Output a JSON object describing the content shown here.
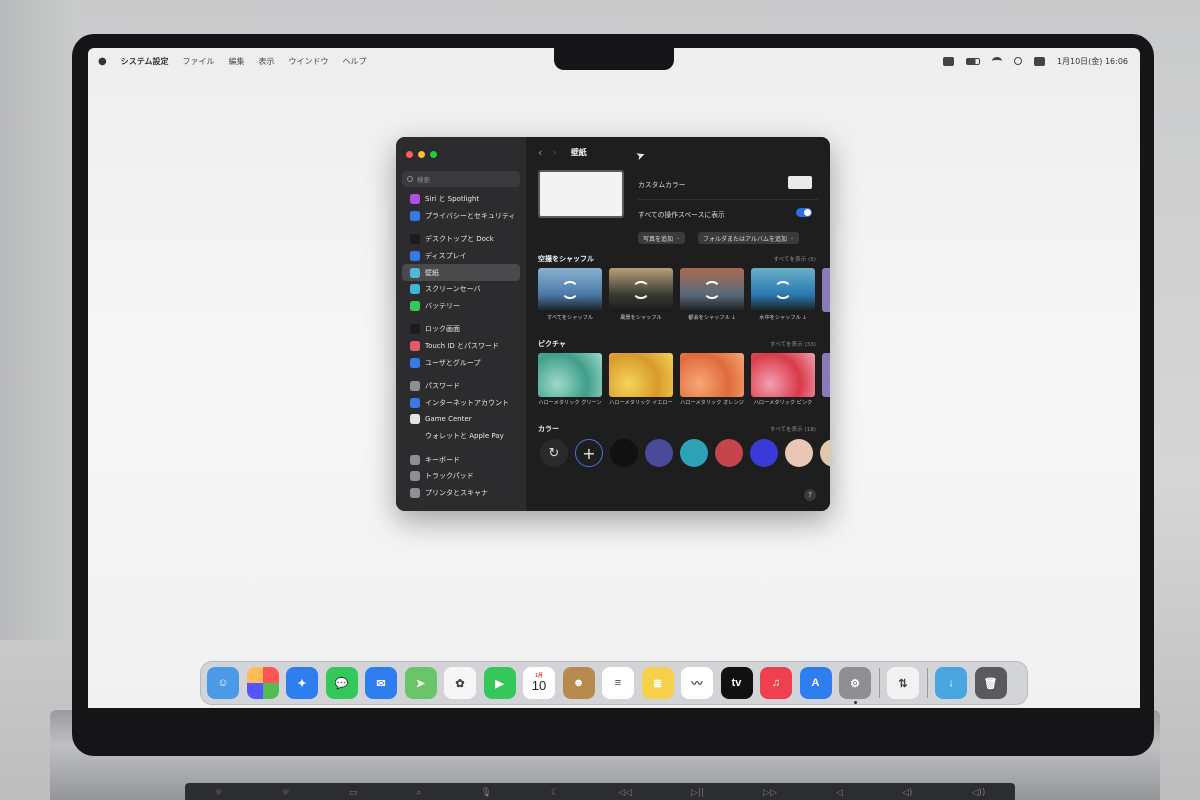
{
  "menubar": {
    "app_name": "システム設定",
    "menus": [
      "ファイル",
      "編集",
      "表示",
      "ウインドウ",
      "ヘルプ"
    ],
    "clock": "1月10日(金) 16:06"
  },
  "window": {
    "search_placeholder": "検索",
    "title": "壁紙",
    "sidebar_groups": [
      [
        {
          "label": "Siri と Spotlight",
          "icon": "siri-icon",
          "color": "#b04fe0"
        },
        {
          "label": "プライバシーとセキュリティ",
          "icon": "hand-icon",
          "color": "#3a7ae8"
        }
      ],
      [
        {
          "label": "デスクトップと Dock",
          "icon": "desktop-icon",
          "color": "#1c1c1e"
        },
        {
          "label": "ディスプレイ",
          "icon": "display-icon",
          "color": "#3a7ae8"
        },
        {
          "label": "壁紙",
          "icon": "wallpaper-icon",
          "color": "#4fb8d8",
          "active": true
        },
        {
          "label": "スクリーンセーバ",
          "icon": "screensaver-icon",
          "color": "#3fb6d6"
        },
        {
          "label": "バッテリー",
          "icon": "battery-icon",
          "color": "#34c759"
        }
      ],
      [
        {
          "label": "ロック画面",
          "icon": "lock-icon",
          "color": "#1c1c1e"
        },
        {
          "label": "Touch ID とパスワード",
          "icon": "fingerprint-icon",
          "color": "#e8566a"
        },
        {
          "label": "ユーザとグループ",
          "icon": "users-icon",
          "color": "#3a7ae8"
        }
      ],
      [
        {
          "label": "パスワード",
          "icon": "key-icon",
          "color": "#8e8e93"
        },
        {
          "label": "インターネットアカウント",
          "icon": "at-icon",
          "color": "#3a7ae8"
        },
        {
          "label": "Game Center",
          "icon": "gamecenter-icon",
          "color": "#e3e3e3"
        },
        {
          "label": "ウォレットと Apple Pay",
          "icon": "wallet-icon",
          "color": "#2b2b2b"
        }
      ],
      [
        {
          "label": "キーボード",
          "icon": "keyboard-icon",
          "color": "#8e8e93"
        },
        {
          "label": "トラックパッド",
          "icon": "trackpad-icon",
          "color": "#8e8e93"
        },
        {
          "label": "プリンタとスキャナ",
          "icon": "printer-icon",
          "color": "#8e8e93"
        }
      ]
    ],
    "custom_color_label": "カスタムカラー",
    "all_spaces_label": "すべての操作スペースに表示",
    "all_spaces_enabled": true,
    "add_photo_label": "写真を追加",
    "add_folder_label": "フォルダまたはアルバムを追加",
    "sections": {
      "shuffle": {
        "title": "空撮をシャッフル",
        "link": "すべてを表示 (5)",
        "items": [
          {
            "caption": "すべてをシャッフル",
            "colors": [
              "#4a7aa8",
              "#8ab0d0"
            ]
          },
          {
            "caption": "風景をシャッフル",
            "colors": [
              "#3a3a34",
              "#b8a078"
            ]
          },
          {
            "caption": "都会をシャッフル ↓",
            "colors": [
              "#5a6a7a",
              "#a86a50"
            ]
          },
          {
            "caption": "水中をシャッフル ↓",
            "colors": [
              "#2a7ab0",
              "#6ab0c8"
            ]
          }
        ]
      },
      "pictures": {
        "title": "ピクチャ",
        "link": "すべてを表示 (33)",
        "items": [
          {
            "caption": "ハローメタリック グリーン",
            "colors": [
              "#9fd8c8",
              "#3f9e8a"
            ]
          },
          {
            "caption": "ハローメタリック イエロー",
            "colors": [
              "#f4d45a",
              "#d89a2a"
            ]
          },
          {
            "caption": "ハローメタリック オレンジ",
            "colors": [
              "#f6a878",
              "#e06a3a"
            ]
          },
          {
            "caption": "ハローメタリック ピンク",
            "colors": [
              "#f2a0b0",
              "#d83a4a"
            ]
          }
        ]
      },
      "colors": {
        "title": "カラー",
        "link": "すべてを表示 (18)",
        "swatches": [
          "#111111",
          "#4a4a9a",
          "#2ea3b8",
          "#c8444c",
          "#3a3ad8",
          "#e8c8b4",
          "#e0c8a8"
        ]
      }
    }
  },
  "dock": {
    "apps": [
      {
        "name": "finder-app",
        "color": "#4a9ae8",
        "glyph": "☺"
      },
      {
        "name": "launchpad-app",
        "color": "#e8e8ea",
        "glyph": ""
      },
      {
        "name": "safari-app",
        "color": "#2f7ef0",
        "glyph": "✦"
      },
      {
        "name": "messages-app",
        "color": "#34c759",
        "glyph": "💬"
      },
      {
        "name": "mail-app",
        "color": "#2f7ef0",
        "glyph": "✉"
      },
      {
        "name": "maps-app",
        "color": "#6ac56a",
        "glyph": "➤"
      },
      {
        "name": "photos-app",
        "color": "#f6f6f6",
        "glyph": "✿"
      },
      {
        "name": "facetime-app",
        "color": "#34c759",
        "glyph": "▶"
      },
      {
        "name": "calendar-app",
        "color": "#ffffff",
        "glyph": ""
      },
      {
        "name": "contacts-app",
        "color": "#b98a4e",
        "glyph": "☻"
      },
      {
        "name": "reminders-app",
        "color": "#ffffff",
        "glyph": "≡"
      },
      {
        "name": "notes-app",
        "color": "#f6d04a",
        "glyph": "≣"
      },
      {
        "name": "freeform-app",
        "color": "#ffffff",
        "glyph": "〰"
      },
      {
        "name": "appletv-app",
        "color": "#111111",
        "glyph": "tv"
      },
      {
        "name": "music-app",
        "color": "#f04050",
        "glyph": "♫"
      },
      {
        "name": "appstore-app",
        "color": "#2f7ef0",
        "glyph": "A"
      },
      {
        "name": "systemsettings-app",
        "color": "#8e8e93",
        "glyph": "⚙"
      }
    ],
    "calendar_month": "1月",
    "calendar_day": "10",
    "after_separator": [
      {
        "name": "migration-assistant-app",
        "color": "#f2f2f2",
        "glyph": "⇅"
      }
    ],
    "trailing": [
      {
        "name": "downloads-folder",
        "color": "#4aa6e0",
        "glyph": "↓"
      },
      {
        "name": "trash-icon",
        "color": "#5a5a5e",
        "glyph": "🗑"
      }
    ]
  }
}
